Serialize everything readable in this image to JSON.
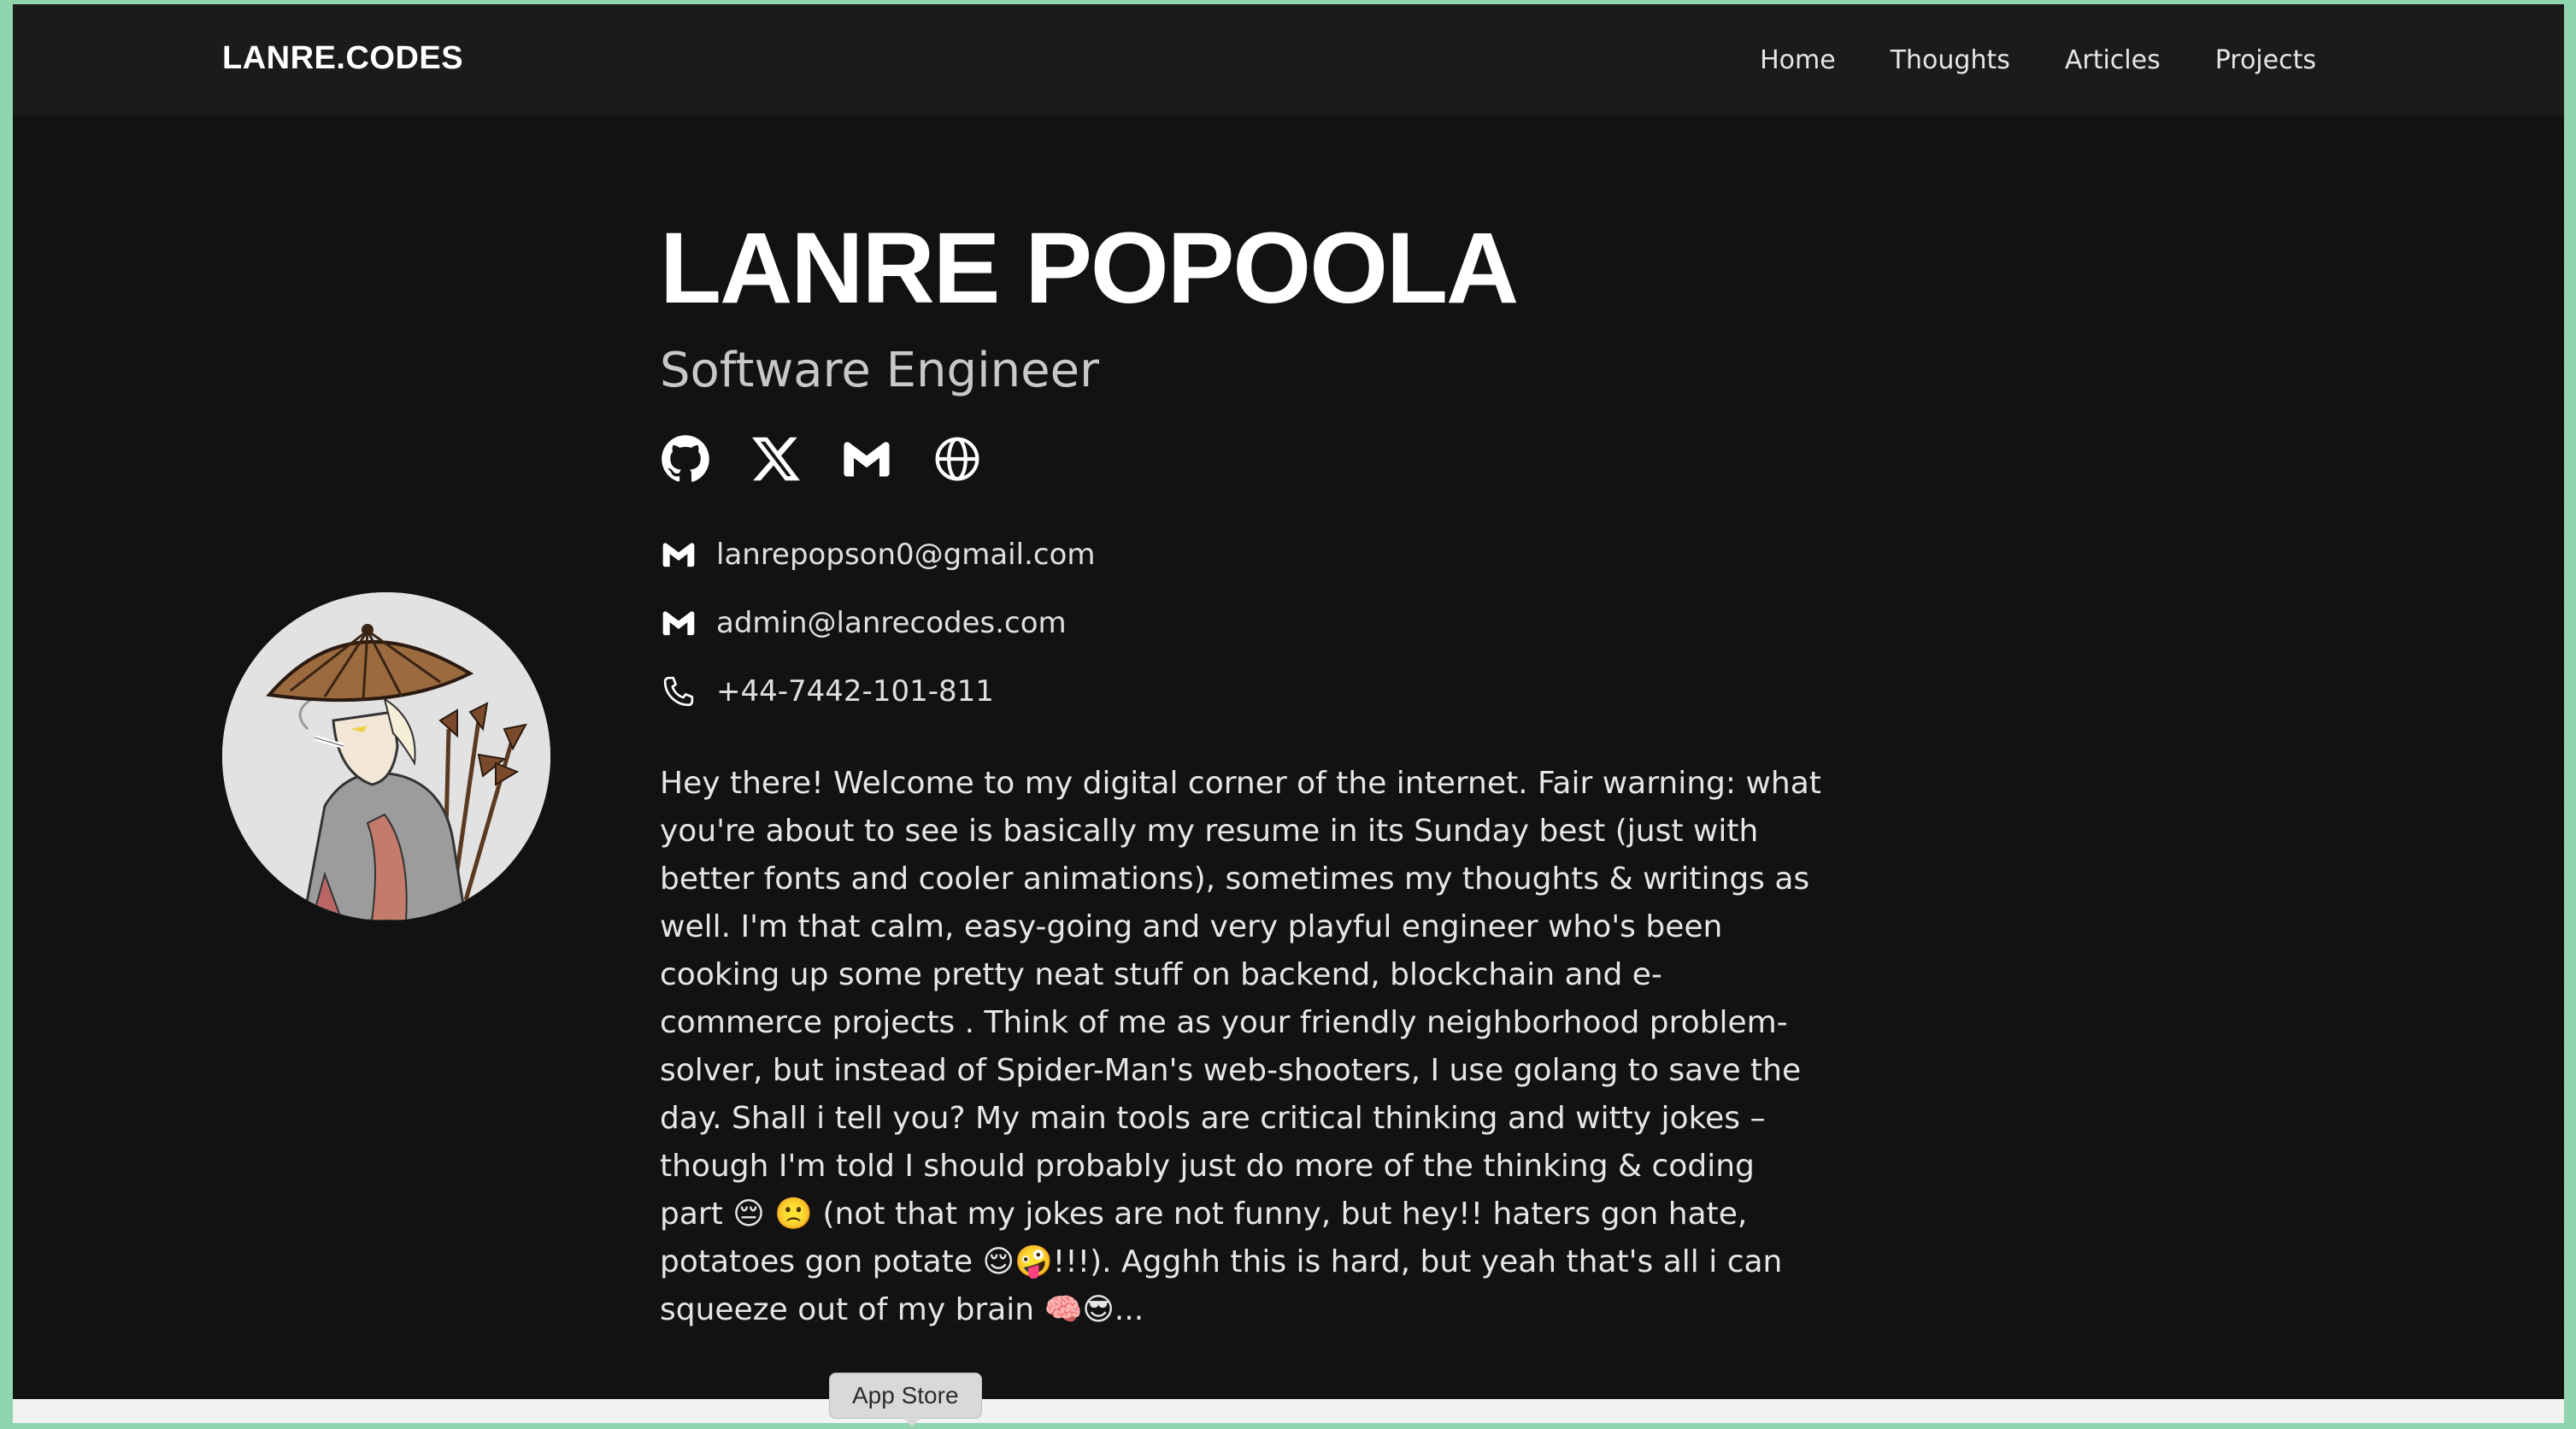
{
  "nav": {
    "logo": "LANRE.CODES",
    "links": [
      "Home",
      "Thoughts",
      "Articles",
      "Projects"
    ]
  },
  "profile": {
    "name": "LANRE POPOOLA",
    "title": "Software Engineer",
    "avatar_icon": "anime-avatar-illustration"
  },
  "socials": [
    {
      "icon": "github-icon"
    },
    {
      "icon": "x-icon"
    },
    {
      "icon": "gmail-icon"
    },
    {
      "icon": "globe-icon"
    }
  ],
  "contacts": [
    {
      "icon": "gmail-icon",
      "text": "lanrepopson0@gmail.com"
    },
    {
      "icon": "gmail-icon",
      "text": "admin@lanrecodes.com"
    },
    {
      "icon": "phone-icon",
      "text": "+44-7442-101-811"
    }
  ],
  "bio": "Hey there! Welcome to my digital corner of the internet. Fair warning: what you're about to see is basically my resume in its Sunday best (just with better fonts and cooler animations), sometimes my thoughts & writings as well. I'm that calm, easy-going and very playful engineer who's been cooking up some pretty neat stuff on backend, blockchain and e-commerce projects . Think of me as your friendly neighborhood problem-solver, but instead of Spider-Man's web-shooters, I use golang to save the day. Shall i tell you? My main tools are critical thinking and witty jokes – though I'm told I should probably just do more of the thinking & coding part 😔 🙁 (not that my jokes are not funny, but hey!! haters gon hate, potatoes gon potate 😌🤪!!!). Agghh this is hard, but yeah that's all i can squeeze out of my brain 🧠😎...",
  "tooltip": "App Store",
  "colors": {
    "background": "#121212",
    "navbar": "#1b1b1b",
    "desktop": "#8fd6ae",
    "text": "#e6e6e6"
  }
}
